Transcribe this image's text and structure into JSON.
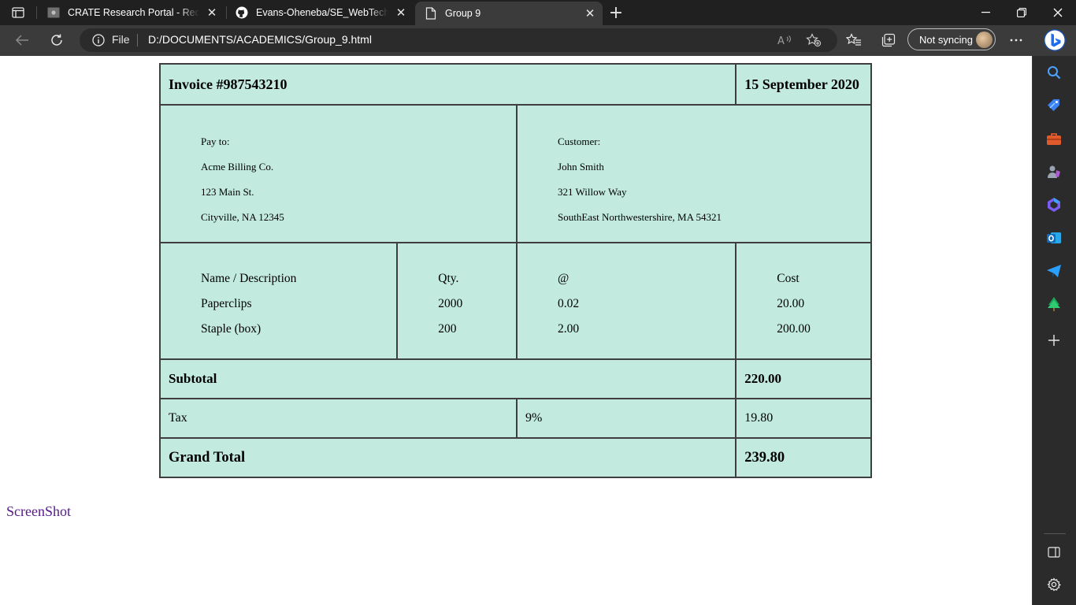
{
  "tabs": [
    {
      "title": "CRATE Research Portal - Request",
      "active": false
    },
    {
      "title": "Evans-Oheneba/SE_WebTech_Rep",
      "active": false
    },
    {
      "title": "Group 9",
      "active": true
    }
  ],
  "address": {
    "scheme_label": "File",
    "url": "D:/DOCUMENTS/ACADEMICS/Group_9.html"
  },
  "profile": {
    "sync_label": "Not syncing"
  },
  "invoice": {
    "number": "Invoice #987543210",
    "date": "15 September 2020",
    "pay_to": {
      "label": "Pay to:",
      "name": "Acme Billing Co.",
      "street": "123 Main St.",
      "city": "Cityville, NA 12345"
    },
    "customer": {
      "label": "Customer:",
      "name": "John Smith",
      "street": "321 Willow Way",
      "city": "SouthEast Northwestershire, MA 54321"
    },
    "columns": {
      "desc": "Name / Description",
      "qty": "Qty.",
      "price": "@",
      "cost": "Cost"
    },
    "items": [
      {
        "desc": "Paperclips",
        "qty": "2000",
        "price": "0.02",
        "cost": "20.00"
      },
      {
        "desc": "Staple (box)",
        "qty": "200",
        "price": "2.00",
        "cost": "200.00"
      }
    ],
    "subtotal_label": "Subtotal",
    "subtotal": "220.00",
    "tax_label": "Tax",
    "tax_rate": "9%",
    "tax": "19.80",
    "grand_total_label": "Grand Total",
    "grand_total": "239.80"
  },
  "link": {
    "text": "ScreenShot"
  },
  "colors": {
    "invoice_bg": "#c2eadf",
    "border": "#3f3f3f",
    "link": "#551a8b",
    "chrome_dark": "#202020",
    "toolbar": "#3b3b3b"
  }
}
